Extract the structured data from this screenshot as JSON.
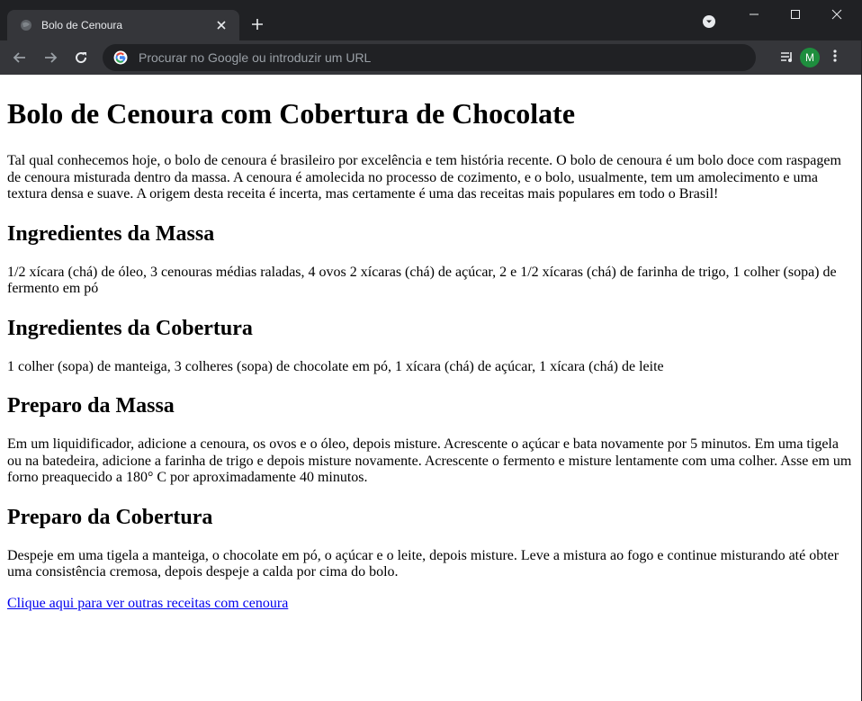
{
  "browser": {
    "tab_title": "Bolo de Cenoura",
    "omnibox_placeholder": "Procurar no Google ou introduzir um URL",
    "profile_initial": "M",
    "colors": {
      "frame": "#202124",
      "toolbar": "#35363a",
      "avatar": "#1e8e3e",
      "link": "#0000ee"
    }
  },
  "page": {
    "title": "Bolo de Cenoura com Cobertura de Chocolate",
    "intro": "Tal qual conhecemos hoje, o bolo de cenoura é brasileiro por excelência e tem história recente. O bolo de cenoura é um bolo doce com raspagem de cenoura misturada dentro da massa. A cenoura é amolecida no processo de cozimento, e o bolo, usualmente, tem um amolecimento e uma textura densa e suave. A origem desta receita é incerta, mas certamente é uma das receitas mais populares em todo o Brasil!",
    "sections": [
      {
        "heading": "Ingredientes da Massa",
        "text": "1/2 xícara (chá) de óleo, 3 cenouras médias raladas, 4 ovos 2 xícaras (chá) de açúcar, 2 e 1/2 xícaras (chá) de farinha de trigo, 1 colher (sopa) de fermento em pó"
      },
      {
        "heading": "Ingredientes da Cobertura",
        "text": "1 colher (sopa) de manteiga, 3 colheres (sopa) de chocolate em pó, 1 xícara (chá) de açúcar, 1 xícara (chá) de leite"
      },
      {
        "heading": "Preparo da Massa",
        "text": "Em um liquidificador, adicione a cenoura, os ovos e o óleo, depois misture. Acrescente o açúcar e bata novamente por 5 minutos. Em uma tigela ou na batedeira, adicione a farinha de trigo e depois misture novamente. Acrescente o fermento e misture lentamente com uma colher. Asse em um forno preaquecido a 180° C por aproximadamente 40 minutos."
      },
      {
        "heading": "Preparo da Cobertura",
        "text": "Despeje em uma tigela a manteiga, o chocolate em pó, o açúcar e o leite, depois misture. Leve a mistura ao fogo e continue misturando até obter uma consistência cremosa, depois despeje a calda por cima do bolo."
      }
    ],
    "link_text": "Clique aqui para ver outras receitas com cenoura"
  }
}
